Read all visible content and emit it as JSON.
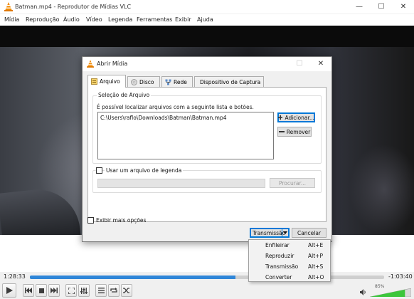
{
  "window": {
    "title": "Batman.mp4 - Reprodutor de Mídias VLC",
    "minimize": "—",
    "maximize": "☐",
    "close": "✕"
  },
  "menubar": [
    "Mídia",
    "Reprodução",
    "Áudio",
    "Vídeo",
    "Legenda",
    "Ferramentas",
    "Exibir",
    "Ajuda"
  ],
  "player": {
    "elapsed": "1:28:33",
    "remaining": "-1:03:40",
    "progress_fraction": 0.58,
    "volume_label": "85%",
    "volume_fraction": 0.85
  },
  "controls_icons": [
    "play-icon",
    "previous-icon",
    "stop-icon",
    "next-icon",
    "fullscreen-icon",
    "extended-settings-icon",
    "playlist-icon",
    "loop-icon",
    "shuffle-icon",
    "speaker-icon"
  ],
  "dialog": {
    "title": "Abrir Mídia",
    "tabs": [
      "Arquivo",
      "Disco",
      "Rede",
      "Dispositivo de Captura"
    ],
    "file_group_label": "Seleção de Arquivo",
    "hint": "É possível localizar arquivos com a seguinte lista e botões.",
    "files": [
      "C:\\Users\\raflo\\Downloads\\Batman\\Batman.mp4"
    ],
    "add_button": "Adicionar...",
    "remove_button": "Remover",
    "subtitle_checkbox": "Usar um arquivo de legenda",
    "browse_button": "Procurar...",
    "more_options": "Exibir mais opções",
    "stream_button": "Transmissão",
    "cancel_button": "Cancelar",
    "close": "✕",
    "maximize": "☐"
  },
  "dropdown": [
    {
      "label": "Enfileirar",
      "shortcut": "Alt+E"
    },
    {
      "label": "Reproduzir",
      "shortcut": "Alt+P"
    },
    {
      "label": "Transmissão",
      "shortcut": "Alt+S"
    },
    {
      "label": "Converter",
      "shortcut": "Alt+O"
    }
  ],
  "colors": {
    "accent": "#0078d7",
    "seek_fill": "#2f86d8",
    "volume_fill": "#3cc63c",
    "vlc_orange": "#f28a00"
  }
}
